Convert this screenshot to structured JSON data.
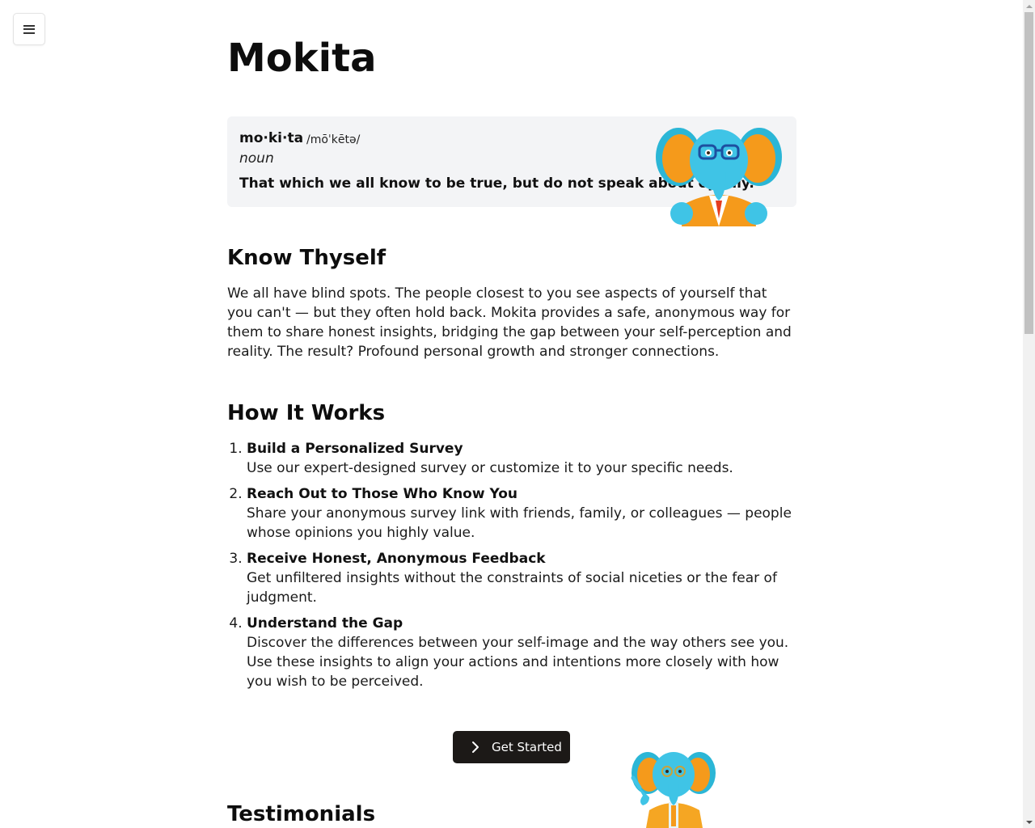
{
  "nav": {
    "menu_icon": "hamburger-menu-icon"
  },
  "header": {
    "title": "Mokita"
  },
  "definition": {
    "word": "mo·ki·ta",
    "pronunciation": "/mōˈkētə/",
    "part_of_speech": "noun",
    "meaning": "That which we all know to be true, but do not speak about openly.",
    "mascot": "elephant-mascot-peeking"
  },
  "know_thyself": {
    "heading": "Know Thyself",
    "body": "We all have blind spots. The people closest to you see aspects of yourself that you can't — but they often hold back. Mokita provides a safe, anonymous way for them to share honest insights, bridging the gap between your self-perception and reality. The result? Profound personal growth and stronger connections."
  },
  "how_it_works": {
    "heading": "How It Works",
    "steps": [
      {
        "title": "Build a Personalized Survey",
        "description": "Use our expert-designed survey or customize it to your specific needs."
      },
      {
        "title": "Reach Out to Those Who Know You",
        "description": "Share your anonymous survey link with friends, family, or colleagues — people whose opinions you highly value."
      },
      {
        "title": "Receive Honest, Anonymous Feedback",
        "description": "Get unfiltered insights without the constraints of social niceties or the fear of judgment."
      },
      {
        "title": "Understand the Gap",
        "description": "Discover the differences between your self-image and the way others see you. Use these insights to align your actions and intentions more closely with how you wish to be perceived."
      }
    ]
  },
  "cta": {
    "label": "Get Started",
    "icon": "chevron-right-icon"
  },
  "testimonials": {
    "heading": "Testimonials",
    "mascot": "elephant-mascot-pointing"
  },
  "colors": {
    "card_bg": "#f3f4f6",
    "button_bg": "#1c1917",
    "mascot_blue": "#3fc4e6",
    "mascot_orange": "#f59a1b"
  }
}
